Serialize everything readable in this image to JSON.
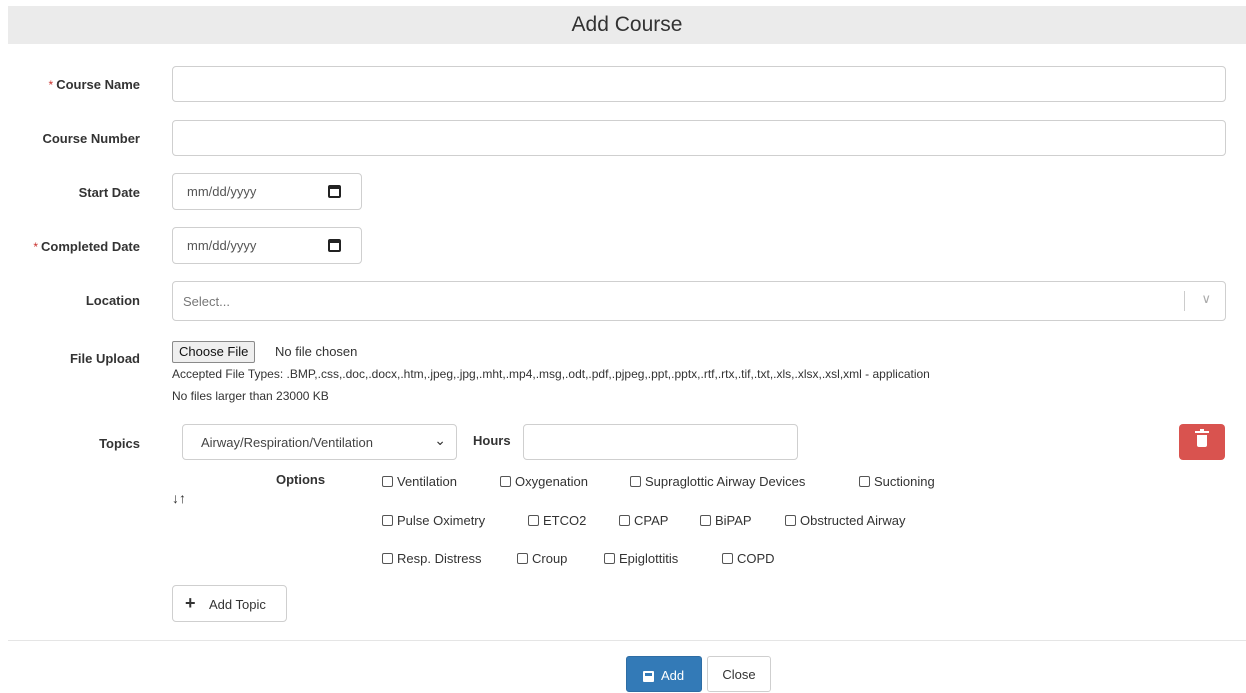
{
  "header": {
    "title": "Add Course"
  },
  "form": {
    "course_name": {
      "label": "Course Name",
      "required_mark": "*",
      "value": ""
    },
    "course_number": {
      "label": "Course Number",
      "value": ""
    },
    "start_date": {
      "label": "Start Date",
      "placeholder": "mm/dd/yyyy"
    },
    "completed_date": {
      "label": "Completed Date",
      "required_mark": "*",
      "placeholder": "mm/dd/yyyy"
    },
    "location": {
      "label": "Location",
      "placeholder": "Select..."
    },
    "file_upload": {
      "label": "File Upload",
      "button": "Choose File",
      "status": "No file chosen",
      "accepted": "Accepted File Types: .BMP,.css,.doc,.docx,.htm,.jpeg,.jpg,.mht,.mp4,.msg,.odt,.pdf,.pjpeg,.ppt,.pptx,.rtf,.rtx,.tif,.txt,.xls,.xlsx,.xsl,xml - application",
      "size_limit": "No files larger than 23000 KB"
    },
    "topics": {
      "label": "Topics",
      "selected_topic": "Airway/Respiration/Ventilation",
      "hours_label": "Hours",
      "hours_value": "",
      "options_label": "Options",
      "options": [
        "Ventilation",
        "Oxygenation",
        "Supraglottic Airway Devices",
        "Suctioning",
        "Pulse Oximetry",
        "ETCO2",
        "CPAP",
        "BiPAP",
        "Obstructed Airway",
        "Resp. Distress",
        "Croup",
        "Epiglottitis",
        "COPD"
      ],
      "add_topic_label": "Add Topic"
    }
  },
  "footer": {
    "add_label": "Add",
    "close_label": "Close"
  },
  "colors": {
    "primary": "#337ab7",
    "danger": "#d9534f",
    "required": "#c9302c",
    "header_bg": "#ebebeb"
  },
  "icons": [
    "calendar-icon",
    "chevron-down-icon",
    "trash-icon",
    "sort-icon",
    "plus-icon",
    "save-icon"
  ]
}
